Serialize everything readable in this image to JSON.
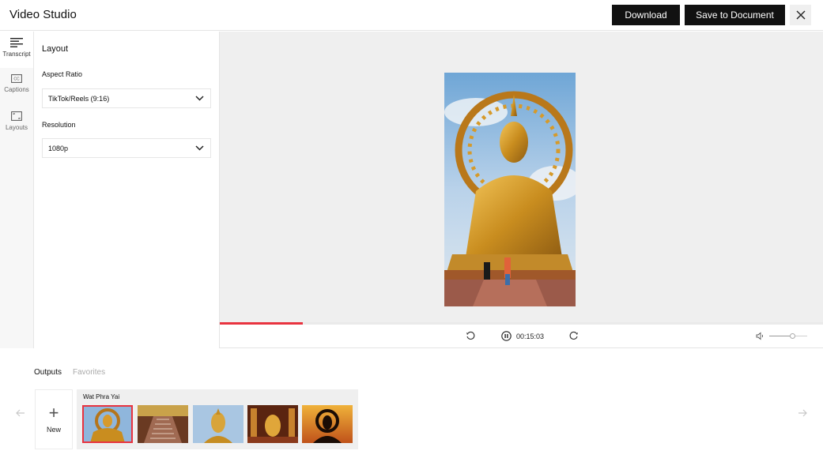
{
  "header": {
    "title": "Video Studio",
    "download_label": "Download",
    "save_label": "Save to Document",
    "close_icon": "close-icon"
  },
  "rail": {
    "items": [
      {
        "label": "Transcript",
        "icon": "transcript-icon",
        "active": true
      },
      {
        "label": "Captions",
        "icon": "captions-icon",
        "active": false
      },
      {
        "label": "Layouts",
        "icon": "layouts-icon",
        "active": false
      }
    ]
  },
  "panel": {
    "title": "Layout",
    "aspect_ratio_label": "Aspect Ratio",
    "aspect_ratio_value": "TikTok/Reels (9:16)",
    "resolution_label": "Resolution",
    "resolution_value": "1080p"
  },
  "player": {
    "progress": 0.138,
    "time": "00:15:03",
    "volume": 0.6,
    "accent_color": "#e8333f"
  },
  "bottom": {
    "tabs": [
      {
        "label": "Outputs",
        "active": true
      },
      {
        "label": "Favorites",
        "active": false
      }
    ],
    "new_label": "New",
    "group_title": "Wat Phra Yai",
    "selected_thumb": 0
  }
}
